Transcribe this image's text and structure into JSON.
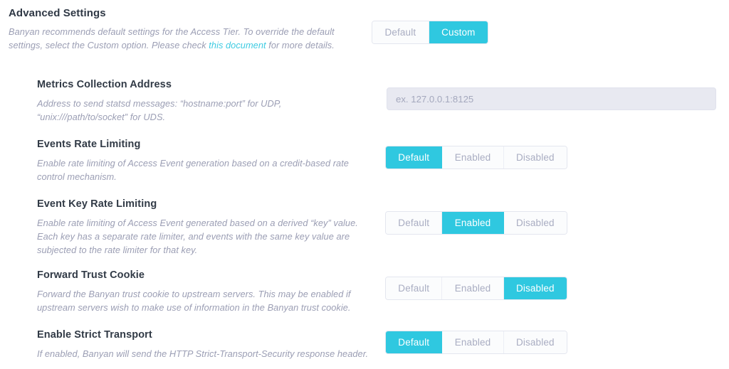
{
  "header": {
    "title": "Advanced Settings",
    "description_part1": "Banyan recommends default settings for the Access Tier. To override the default settings, select the Custom option. Please check ",
    "link_text": "this document",
    "description_part2": " for more details."
  },
  "mode_toggle": {
    "options": [
      "Default",
      "Custom"
    ],
    "selected": "Custom"
  },
  "colors": {
    "accent": "#2fc8e0",
    "title": "#313a46",
    "description": "#9b9eb4",
    "input_background": "#e8e9f1"
  },
  "settings": [
    {
      "title": "Metrics Collection Address",
      "description": "Address to send statsd messages: “hostname:port” for UDP, “unix:///path/to/socket” for UDS.",
      "control": "text-input",
      "placeholder": "ex. 127.0.0.1:8125",
      "value": ""
    },
    {
      "title": "Events Rate Limiting",
      "description": "Enable rate limiting of Access Event generation based on a credit-based rate control mechanism.",
      "control": "tri-toggle",
      "options": [
        "Default",
        "Enabled",
        "Disabled"
      ],
      "selected": "Default"
    },
    {
      "title": "Event Key Rate Limiting",
      "description": "Enable rate limiting of Access Event generated based on a derived “key” value. Each key has a separate rate limiter, and events with the same key value are subjected to the rate limiter for that key.",
      "control": "tri-toggle",
      "options": [
        "Default",
        "Enabled",
        "Disabled"
      ],
      "selected": "Enabled"
    },
    {
      "title": "Forward Trust Cookie",
      "description": "Forward the Banyan trust cookie to upstream servers. This may be enabled if upstream servers wish to make use of information in the Banyan trust cookie.",
      "control": "tri-toggle",
      "options": [
        "Default",
        "Enabled",
        "Disabled"
      ],
      "selected": "Disabled"
    },
    {
      "title": "Enable Strict Transport",
      "description": "If enabled, Banyan will send the HTTP Strict-Transport-Security response header.",
      "control": "tri-toggle",
      "options": [
        "Default",
        "Enabled",
        "Disabled"
      ],
      "selected": "Default"
    }
  ]
}
